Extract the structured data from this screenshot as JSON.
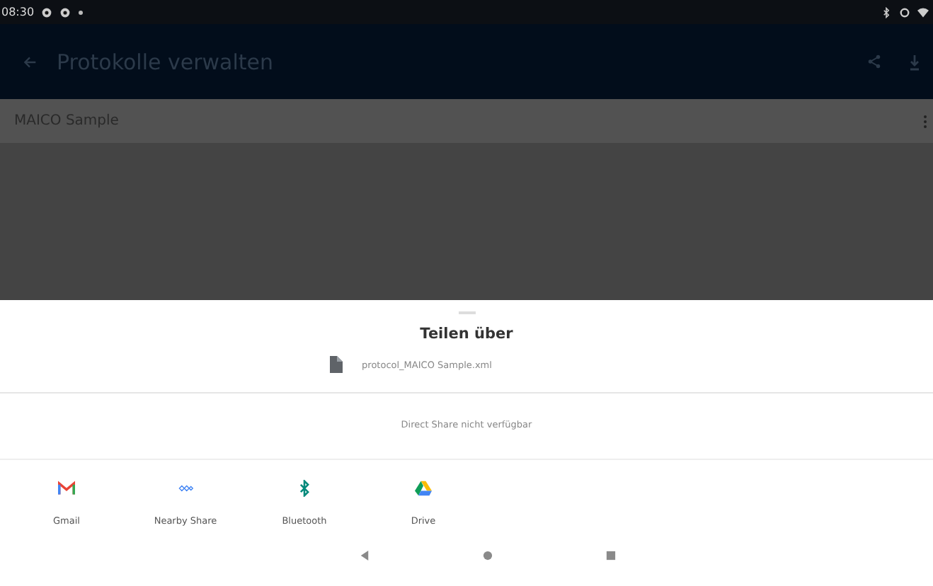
{
  "status_bar": {
    "time": "08:30"
  },
  "app_bar": {
    "title": "Protokolle verwalten"
  },
  "list": [
    {
      "label": "MAICO Sample"
    }
  ],
  "share_sheet": {
    "title": "Teilen über",
    "file_name": "protocol_MAICO Sample.xml",
    "direct_share_message": "Direct Share nicht verfügbar",
    "apps": [
      {
        "kind": "gmail",
        "label": "Gmail"
      },
      {
        "kind": "nearby",
        "label": "Nearby Share"
      },
      {
        "kind": "bluetooth",
        "label": "Bluetooth"
      },
      {
        "kind": "drive",
        "label": "Drive"
      }
    ]
  }
}
